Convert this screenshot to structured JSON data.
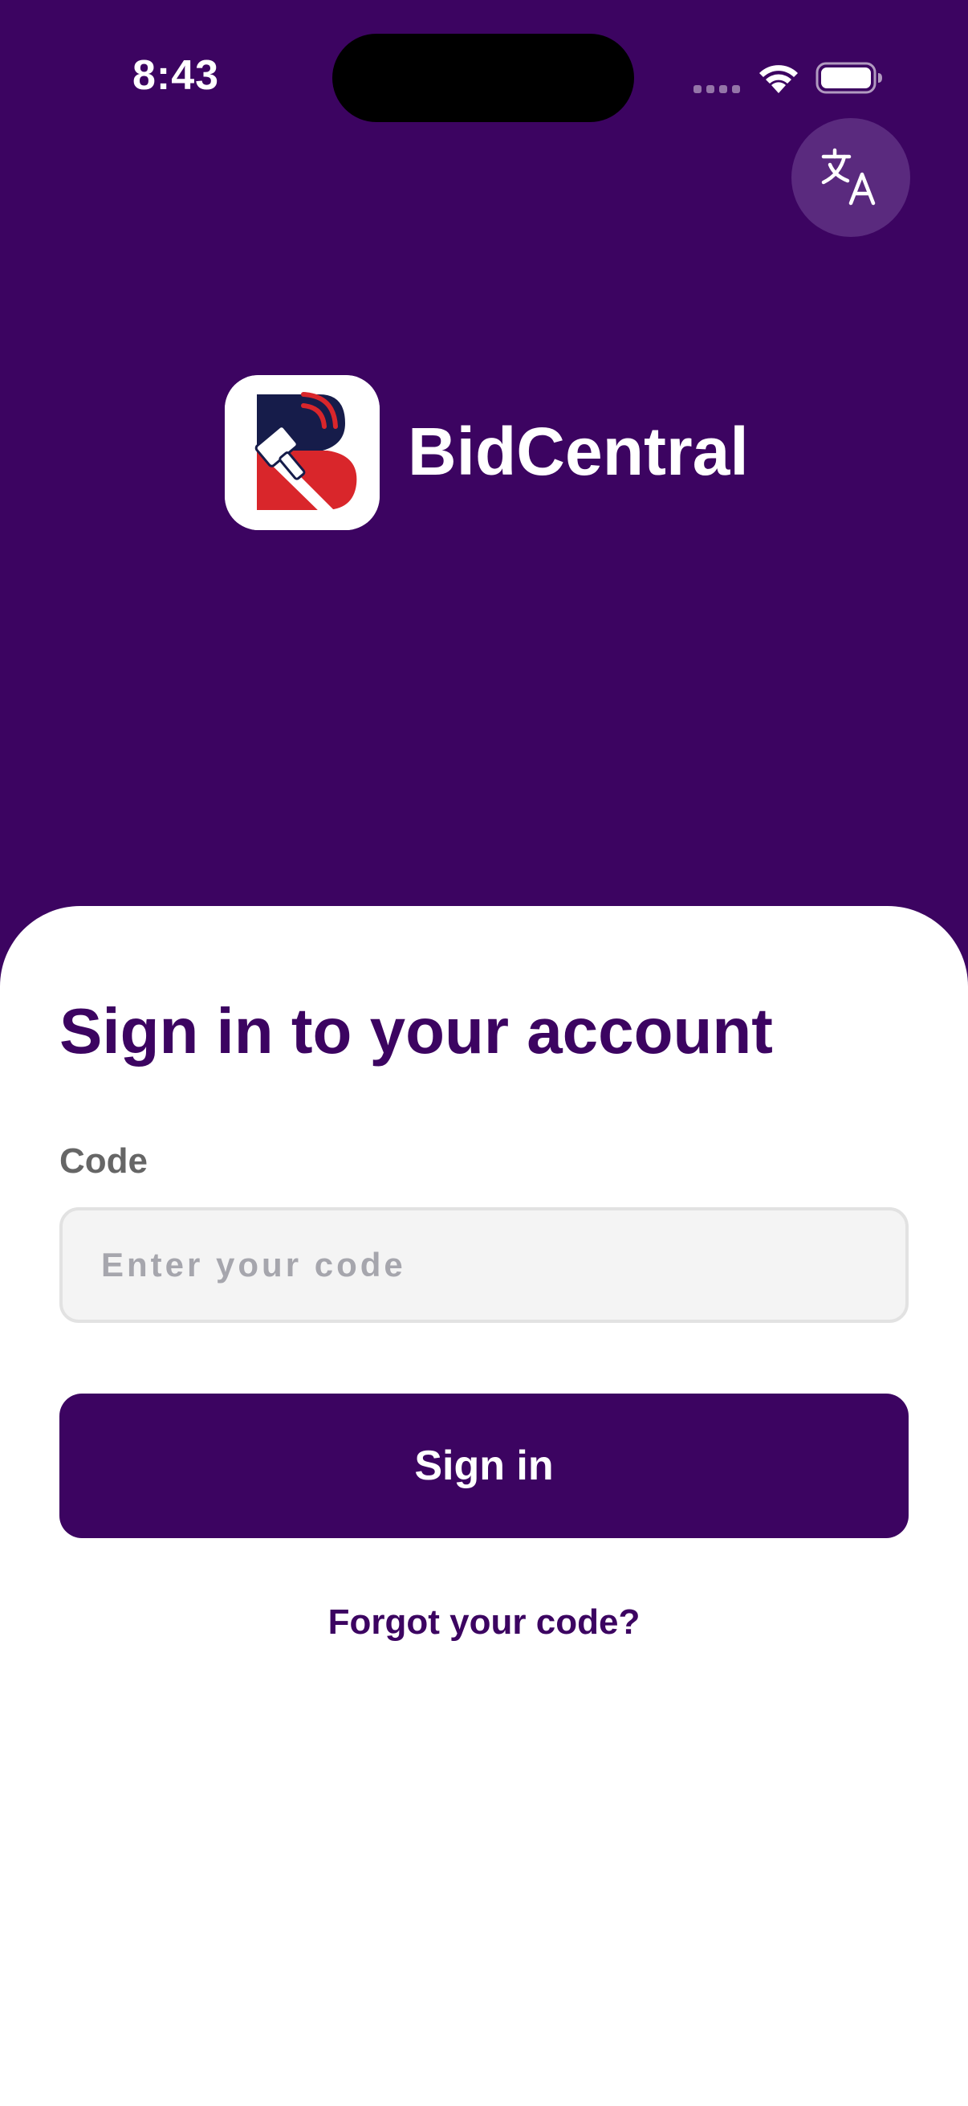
{
  "status_bar": {
    "time": "8:43",
    "icons": [
      "cellular-signal-icon",
      "wifi-icon",
      "battery-icon"
    ]
  },
  "header": {
    "translate_icon": "translate-icon",
    "app_name": "BidCentral",
    "logo_icon": "bidcentral-logo-icon"
  },
  "sign_in": {
    "title": "Sign in to your account",
    "code_label": "Code",
    "code_placeholder": "Enter your code",
    "code_value": "",
    "submit_label": "Sign in",
    "forgot_label": "Forgot your code?"
  },
  "colors": {
    "brand_purple": "#3c0461",
    "translate_button_bg": "#5a2a7e",
    "logo_navy": "#161c4a",
    "logo_red": "#d9262b",
    "input_bg": "#f4f4f4",
    "input_border": "#e2e2e2",
    "label_gray": "#666666"
  }
}
